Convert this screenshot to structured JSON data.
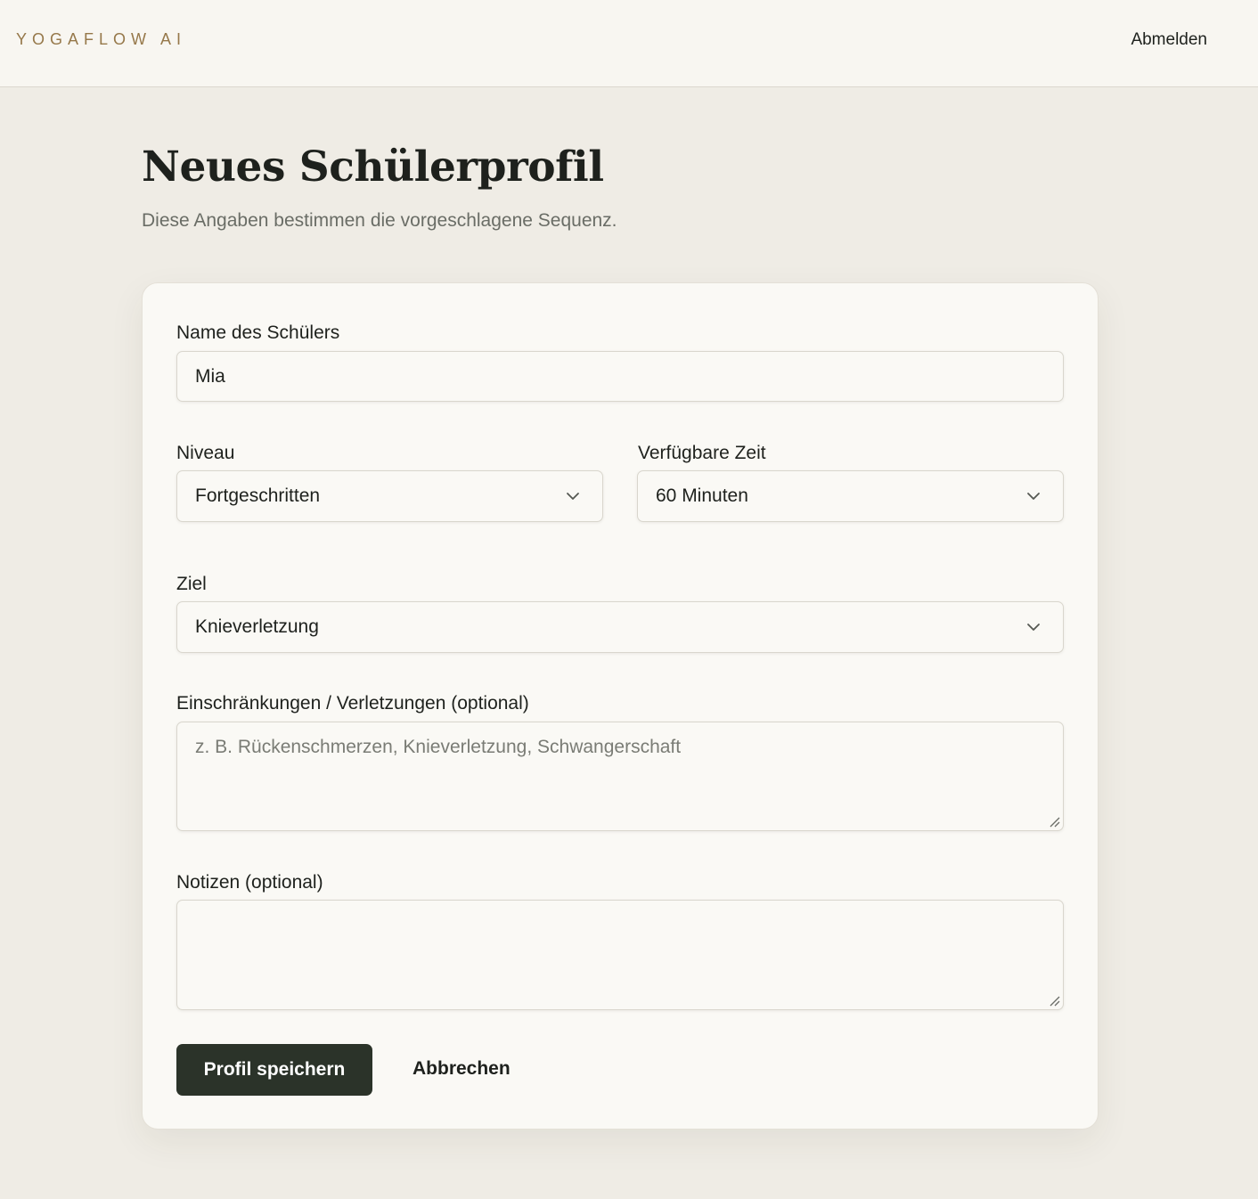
{
  "app": {
    "logo": "YOGAFLOW AI",
    "logout_label": "Abmelden"
  },
  "page": {
    "title": "Neues Schülerprofil",
    "subtitle": "Diese Angaben bestimmen die vorgeschlagene Sequenz."
  },
  "form": {
    "name": {
      "label": "Name des Schülers",
      "value": "Mia"
    },
    "level": {
      "label": "Niveau",
      "selected": "Fortgeschritten",
      "icon": "chevron-down-icon"
    },
    "time": {
      "label": "Verfügbare Zeit",
      "selected": "60 Minuten",
      "icon": "chevron-down-icon"
    },
    "goal": {
      "label": "Ziel",
      "selected": "Knieverletzung",
      "icon": "chevron-down-icon"
    },
    "restrictions": {
      "label": "Einschränkungen / Verletzungen (optional)",
      "placeholder": "z. B. Rückenschmerzen, Knieverletzung, Schwangerschaft",
      "value": ""
    },
    "notes": {
      "label": "Notizen (optional)",
      "value": ""
    },
    "save_label": "Profil speichern",
    "cancel_label": "Abbrechen"
  },
  "colors": {
    "background": "#efece5",
    "header_bg": "#f8f6f1",
    "card_bg": "#faf9f5",
    "logo": "#96784a",
    "primary_button": "#2b3329",
    "text": "#1e211d",
    "muted_text": "#6a6d66"
  }
}
